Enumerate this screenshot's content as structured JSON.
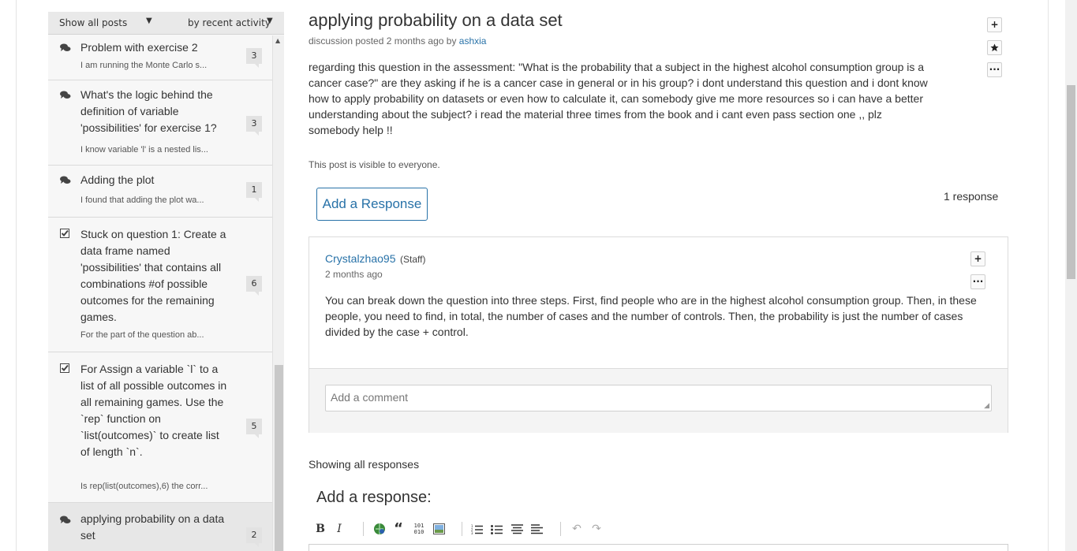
{
  "sidebar": {
    "filter_label": "Show all posts",
    "sort_label": "by recent activity",
    "posts": [
      {
        "icon": "discussion-icon",
        "title": "Problem with exercise 2",
        "preview": "I am running the Monte Carlo s...",
        "count": "3"
      },
      {
        "icon": "discussion-icon",
        "title": "What's the logic behind the definition of variable 'possibilities' for exercise 1?",
        "preview": "I know variable 'l' is a nested lis...",
        "count": "3"
      },
      {
        "icon": "discussion-icon",
        "title": "Adding the plot",
        "preview": "I found that adding the plot wa...",
        "count": "1"
      },
      {
        "icon": "check-icon",
        "title": "Stuck on question 1: Create a data frame named 'possibilities' that contains all combinations #of possible outcomes for the remaining games.",
        "preview": "For the part of the question ab...",
        "count": "6"
      },
      {
        "icon": "check-icon",
        "title": "For Assign a variable `l` to a list of all possible outcomes in all remaining games. Use the `rep` function on `list(outcomes)` to create list of length `n`.",
        "preview": "Is rep(list(outcomes),6) the corr...",
        "count": "5"
      },
      {
        "icon": "discussion-icon",
        "title": "applying probability on a data set",
        "preview": "",
        "count": "2"
      }
    ]
  },
  "thread": {
    "title": "applying probability on a data set",
    "meta_prefix": "discussion posted 2 months ago by",
    "author": "ashxia",
    "body": "regarding this question in the assessment: \"What is the probability that a subject in the highest alcohol consumption group is a cancer case?\" are they asking if he is a cancer case in general or in his group? i dont understand this question and i dont know how to apply probability on datasets or even how to calculate it, can somebody give me more resources so i can have a better understanding about the subject? i read the material three times from the book and i cant even pass section one ,, plz somebody help !!",
    "visibility": "This post is visible to everyone.",
    "add_response_label": "Add a Response",
    "response_count": "1 response"
  },
  "response": {
    "author": "Crystalzhao95",
    "role": "(Staff)",
    "time": "2 months ago",
    "body": "You can break down the question into three steps. First, find people who are in the highest alcohol consumption group. Then, in these people, you need to find, in total, the number of cases and the number of controls. Then, the probability is just the number of cases divided by the case + control.",
    "comment_placeholder": "Add a comment"
  },
  "footer": {
    "showing": "Showing all responses",
    "add_response_heading": "Add a response:"
  },
  "toolbar": {
    "bold": "B",
    "italic": "I",
    "quote": "“",
    "code": "101\n010"
  }
}
